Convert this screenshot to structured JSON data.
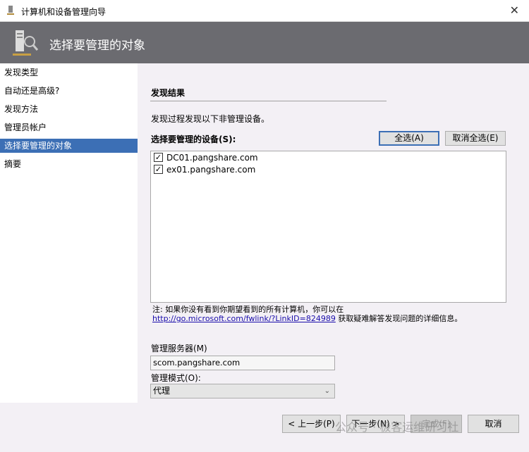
{
  "window": {
    "title": "计算机和设备管理向导",
    "close_label": "✕"
  },
  "header": {
    "title": "选择要管理的对象"
  },
  "sidebar": {
    "items": [
      {
        "label": "发现类型",
        "selected": false
      },
      {
        "label": "自动还是高级?",
        "selected": false
      },
      {
        "label": "发现方法",
        "selected": false
      },
      {
        "label": "管理员帐户",
        "selected": false
      },
      {
        "label": "选择要管理的对象",
        "selected": true
      },
      {
        "label": "摘要",
        "selected": false
      }
    ]
  },
  "main": {
    "section_title": "发现结果",
    "description": "发现过程发现以下非管理设备。",
    "devices_label": "选择要管理的设备(S):",
    "select_all": "全选(A)",
    "deselect_all": "取消全选(E)",
    "devices": [
      {
        "name": "DC01.pangshare.com",
        "checked": true
      },
      {
        "name": "ex01.pangshare.com",
        "checked": true
      }
    ],
    "note_text": "注: 如果你没有看到你期望看到的所有计算机，你可以在",
    "note_link": "http://go.microsoft.com/fwlink/?LinkID=824989",
    "note_suffix": " 获取疑难解答发现问题的详细信息。",
    "server_label": "管理服务器(M)",
    "server_value": "scom.pangshare.com",
    "mode_label": "管理模式(O):",
    "mode_value": "代理"
  },
  "footer": {
    "back": "< 上一步(P)",
    "next": "下一步(N) >",
    "finish": "完成(F)",
    "cancel": "取消"
  },
  "watermark": "公众号 · 极客运维研习社",
  "colors": {
    "header_bg": "#6b6b70",
    "selection": "#3c6fb5",
    "link": "#1a0dab"
  }
}
